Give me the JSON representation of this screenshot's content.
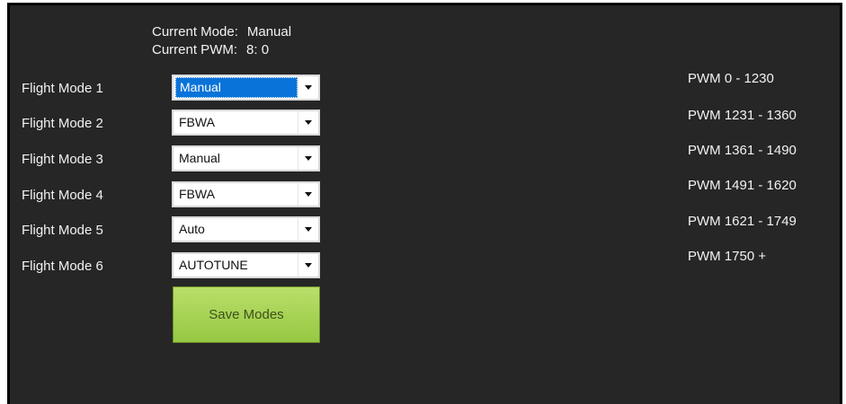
{
  "status": {
    "mode_label": "Current Mode:",
    "mode_value": "Manual",
    "pwm_label": "Current PWM:",
    "pwm_value": "8: 0"
  },
  "flight_modes": [
    {
      "label": "Flight Mode 1",
      "value": "Manual",
      "selected": true
    },
    {
      "label": "Flight Mode 2",
      "value": "FBWA"
    },
    {
      "label": "Flight Mode 3",
      "value": "Manual"
    },
    {
      "label": "Flight Mode 4",
      "value": "FBWA"
    },
    {
      "label": "Flight Mode 5",
      "value": "Auto"
    },
    {
      "label": "Flight Mode 6",
      "value": "AUTOTUNE"
    }
  ],
  "save_button": {
    "label": "Save Modes"
  },
  "pwm_ranges": [
    "PWM 0 - 1230",
    "PWM 1231 - 1360",
    "PWM 1361 - 1490",
    "PWM 1491 - 1620",
    "PWM 1621 - 1749",
    "PWM 1750 +"
  ],
  "colors": {
    "panel_background": "#262626",
    "selection_highlight": "#0a73d9",
    "save_button_green": "#a8d456"
  },
  "icons": {
    "dropdown": "chevron-down-icon"
  }
}
